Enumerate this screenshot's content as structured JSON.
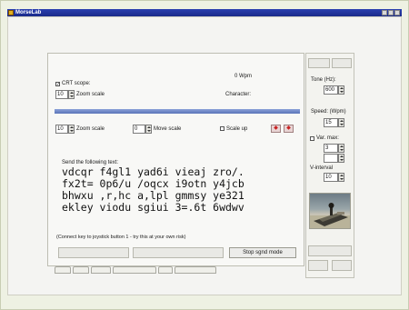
{
  "window": {
    "title": "MorseLab"
  },
  "top": {
    "wpm_label": "0 Wpm",
    "character_label": "Character:",
    "crt_scope_label": "CRT scope:",
    "crt_scope_checked": true,
    "zoom_scale_value": "10",
    "zoom_scale_label": "Zoom scale"
  },
  "row2": {
    "zoom_value": "10",
    "zoom_label": "Zoom scale",
    "move_value": "0",
    "move_label": "Move scale",
    "scale_label": "Scale up"
  },
  "text_area": {
    "heading": "Send the following text:",
    "lines": [
      "vdcqr f4gl1 yad6i vieaj zro/.",
      "fx2t= 0p6/u /oqcx i9otn y4jcb",
      "bhwxu ,r,hc a,lpl gmmsy ye321",
      "ekley viodu sgiui 3=.6t 6wdwv"
    ]
  },
  "footer": {
    "note": "(Connect key to joystick button 1 - try this at your own risk)",
    "stop_button": "Stop sgnd mode"
  },
  "right": {
    "tone_label": "Tone (Hz):",
    "tone_value": "600",
    "speed_label": "Speed: (Wpm)",
    "speed_value": "15",
    "var_max_label": "Var. max:",
    "var_max_value": "3",
    "v_interval_label": "V-interval",
    "v_interval_value": "10"
  },
  "colors": {
    "title_bar": "#1a2a8a",
    "accent_bar": "#5a74b8",
    "arrow_red": "#c82020"
  }
}
